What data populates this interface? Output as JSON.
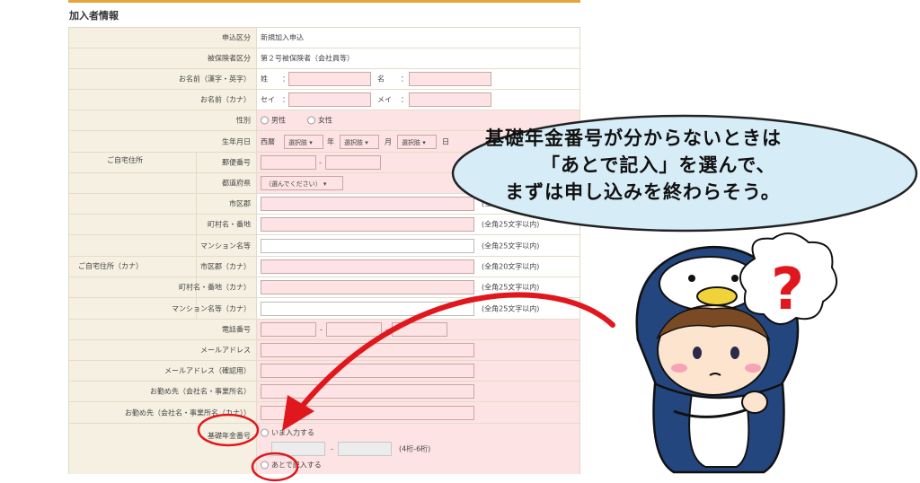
{
  "section_title": "加入者情報",
  "rows": {
    "application_type": {
      "label": "申込区分",
      "value": "新規加入申込"
    },
    "insured_type": {
      "label": "被保険者区分",
      "value": "第２号被保険者（会社員等）"
    },
    "name_kanji": {
      "label": "お名前（漢字・英字）",
      "sei": "姓",
      "colon": "：",
      "mei": "名"
    },
    "name_kana": {
      "label": "お名前（カナ）",
      "sei": "セイ",
      "colon": "：",
      "mei": "メイ"
    },
    "gender": {
      "label": "性別",
      "male": "男性",
      "female": "女性"
    },
    "birthdate": {
      "label": "生年月日",
      "era": "西暦",
      "select": "選択肢",
      "year": "年",
      "month": "月",
      "day": "日"
    },
    "home_address_group": "ご自宅住所",
    "postal_code": {
      "label": "郵便番号",
      "dash": "-"
    },
    "prefecture": {
      "label": "都道府県",
      "select": "（選んでください）"
    },
    "city": {
      "label": "市区郡",
      "limit": "(全角20文字以内)"
    },
    "town": {
      "label": "町村名・番地",
      "limit": "(全角25文字以内)"
    },
    "building": {
      "label": "マンション名等",
      "limit": "(全角25文字以内)"
    },
    "home_address_kana_group": "ご自宅住所（カナ）",
    "city_kana": {
      "label": "市区郡（カナ）",
      "limit": "(全角20文字以内)"
    },
    "town_kana": {
      "label": "町村名・番地（カナ）",
      "limit": "(全角25文字以内)"
    },
    "building_kana": {
      "label": "マンション名等（カナ）",
      "limit": "(全角25文字以内)"
    },
    "phone": {
      "label": "電話番号",
      "dash": "-"
    },
    "email": {
      "label": "メールアドレス"
    },
    "email_confirm": {
      "label": "メールアドレス（確認用）"
    },
    "employer": {
      "label": "お勤め先（会社名・事業所名）"
    },
    "employer_kana": {
      "label": "お勤め先（会社名・事業所名（カナ））"
    },
    "pension_number": {
      "label": "基礎年金番号",
      "option_now": "いま入力する",
      "dash": "-",
      "digits_hint": "(4桁-6桁)",
      "option_later": "あとで記入する"
    }
  },
  "callout": {
    "line1": "基礎年金番号が分からないときは",
    "line2": "「あとで記入」を選んで、",
    "line3": "まずは申し込みを終わらそう。"
  },
  "colors": {
    "accent": "#e8a33a",
    "label_bg": "#f5f0e1",
    "required_bg": "#fde3e3",
    "annotation_red": "#e0181e",
    "bubble_fill": "#d6ecf6"
  },
  "icons": {
    "question": "question-mark-icon",
    "arrow": "red-arrow-icon",
    "character": "penguin-costume-character-icon"
  }
}
